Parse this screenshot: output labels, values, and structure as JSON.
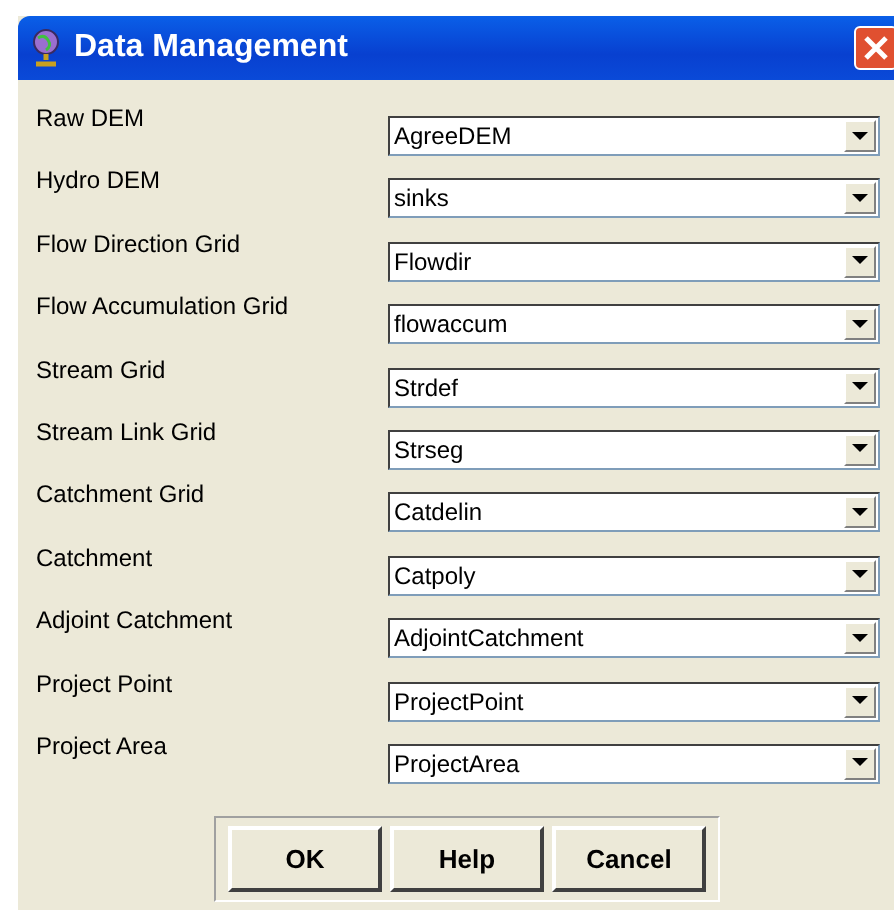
{
  "window": {
    "title": "Data Management"
  },
  "fields": [
    {
      "label": "Raw DEM",
      "value": "AgreeDEM"
    },
    {
      "label": "Hydro DEM",
      "value": "sinks"
    },
    {
      "label": "Flow Direction Grid",
      "value": "Flowdir"
    },
    {
      "label": "Flow Accumulation Grid",
      "value": "flowaccum"
    },
    {
      "label": "Stream Grid",
      "value": "Strdef"
    },
    {
      "label": "Stream Link Grid",
      "value": "Strseg"
    },
    {
      "label": "Catchment Grid",
      "value": "Catdelin"
    },
    {
      "label": "Catchment",
      "value": "Catpoly"
    },
    {
      "label": "Adjoint Catchment",
      "value": "AdjointCatchment"
    },
    {
      "label": "Project Point",
      "value": "ProjectPoint"
    },
    {
      "label": "Project Area",
      "value": "ProjectArea"
    }
  ],
  "buttons": [
    "OK",
    "Help",
    "Cancel"
  ]
}
